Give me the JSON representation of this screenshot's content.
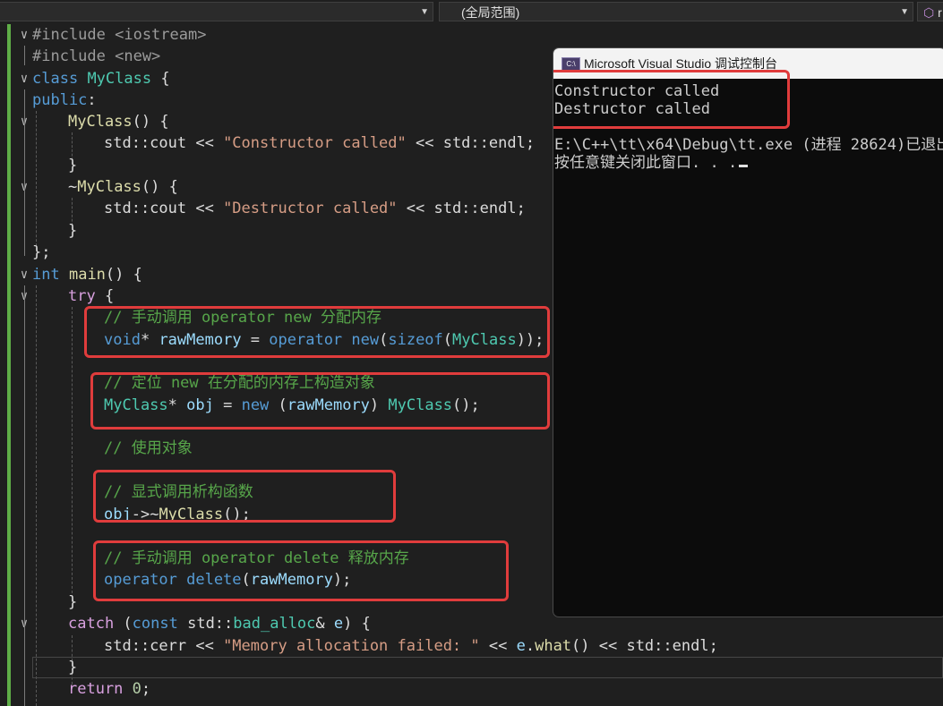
{
  "toolbar": {
    "scope_selector": "(全局范围)",
    "right_selector_icon": "cube-icon",
    "right_selector_text": "r"
  },
  "editor": {
    "lines": {
      "l1": "#include <iostream>",
      "l2": "#include <new>",
      "l3a": "class",
      "l3b": "MyClass",
      "l3c": " {",
      "l4a": "public",
      "l4b": ":",
      "l5a": "MyClass",
      "l5b": "() {",
      "l6a": "std::cout << ",
      "l6b": "\"Constructor called\"",
      "l6c": " << std::endl;",
      "l7": "}",
      "l8a": "~",
      "l8b": "MyClass",
      "l8c": "() {",
      "l9a": "std::cout << ",
      "l9b": "\"Destructor called\"",
      "l9c": " << std::endl;",
      "l10": "}",
      "l11": "};",
      "l12a": "int",
      "l12b": " ",
      "l12c": "main",
      "l12d": "() {",
      "l13a": "try",
      "l13b": " {",
      "l14": "// 手动调用 operator new 分配内存",
      "l15a": "void",
      "l15b": "* ",
      "l15c": "rawMemory",
      "l15d": " = ",
      "l15e": "operator new",
      "l15f": "(",
      "l15g": "sizeof",
      "l15h": "(",
      "l15i": "MyClass",
      "l15j": "));",
      "l16": "// 定位 new 在分配的内存上构造对象",
      "l17a": "MyClass",
      "l17b": "* ",
      "l17c": "obj",
      "l17d": " = ",
      "l17e": "new",
      "l17f": " (",
      "l17g": "rawMemory",
      "l17h": ") ",
      "l17i": "MyClass",
      "l17j": "();",
      "l18": "// 使用对象",
      "l19": "// 显式调用析构函数",
      "l20a": "obj",
      "l20b": "->~",
      "l20c": "MyClass",
      "l20d": "();",
      "l21": "// 手动调用 operator delete 释放内存",
      "l22a": "operator delete",
      "l22b": "(",
      "l22c": "rawMemory",
      "l22d": ");",
      "l23": "}",
      "l24a": "catch",
      "l24b": " (",
      "l24c": "const",
      "l24d": " std::",
      "l24e": "bad_alloc",
      "l24f": "& ",
      "l24g": "e",
      "l24h": ") {",
      "l25a": "std::cerr << ",
      "l25b": "\"Memory allocation failed: \"",
      "l25c": " << ",
      "l25d": "e",
      "l25e": ".",
      "l25f": "what",
      "l25g": "() << std::endl;",
      "l26": "}",
      "l27a": "return",
      "l27b": " ",
      "l27c": "0",
      "l27d": ";"
    },
    "colors": {
      "keyword": "#569cd6",
      "control": "#d8a0df",
      "type": "#4ec9b0",
      "string": "#d69d85",
      "comment": "#57a64a",
      "highlight_box": "#e03c3c"
    }
  },
  "console": {
    "icon_text": "C:\\",
    "title": "Microsoft Visual Studio 调试控制台",
    "output": [
      "Constructor called",
      "Destructor called",
      "",
      "E:\\C++\\tt\\x64\\Debug\\tt.exe (进程 28624)已退出",
      "按任意键关闭此窗口. . ."
    ]
  }
}
